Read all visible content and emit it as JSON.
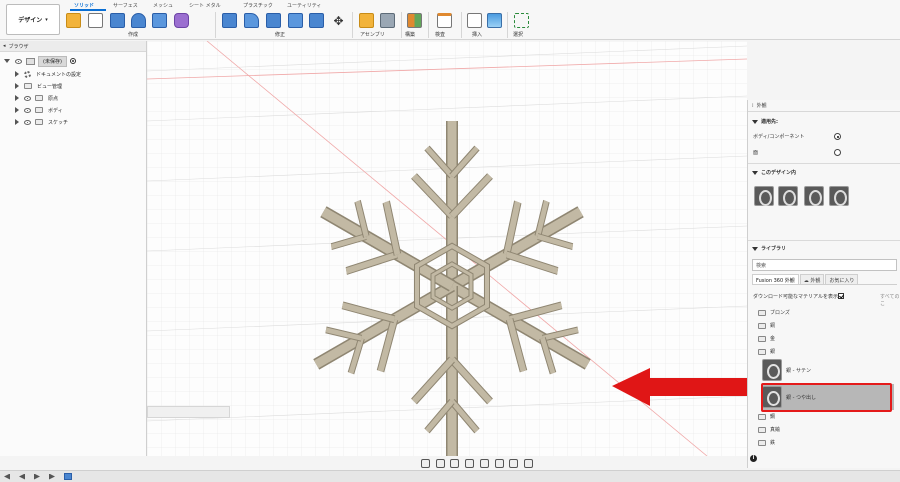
{
  "toolbar": {
    "design_button": "デザイン",
    "tabs": [
      "ソリッド",
      "サーフェス",
      "メッシュ",
      "シート メタル",
      "プラスチック",
      "ユーティリティ"
    ],
    "groups": [
      "作成",
      "修正",
      "アセンブリ",
      "構築",
      "検査",
      "挿入",
      "選択"
    ]
  },
  "browser": {
    "title": "ブラウザ",
    "root": "(未保存)",
    "items": [
      "ドキュメントの設定",
      "ビュー管理",
      "原点",
      "ボディ",
      "スケッチ"
    ]
  },
  "appearance": {
    "title": "外観",
    "apply_to": {
      "heading": "適用先:",
      "options": [
        "ボディ/コンポーネント",
        "面"
      ],
      "selected": "ボディ/コンポーネント"
    },
    "in_design": {
      "heading": "このデザイン内",
      "count": 4
    },
    "library": {
      "heading": "ライブラリ",
      "search_placeholder": "検索",
      "tabs": [
        "Fusion 360 外観",
        "外観",
        "お気に入り"
      ],
      "downloadable_label": "ダウンロード可能なマテリアルを表示",
      "downloadable_checked": true,
      "grey_hint": "すべてのこ",
      "folders_top": [
        "ブロンズ",
        "銅",
        "金",
        "銀"
      ],
      "materials": [
        "銀 - サテン",
        "銀 - つや出し"
      ],
      "selected_material": "銀 - つや出し",
      "folders_bottom": [
        "鋼",
        "真鍮",
        "鉄"
      ]
    }
  },
  "colors": {
    "accent": "#0a6fd4",
    "highlight_box": "#e41a1a",
    "arrow": "#e01616",
    "snowflake": "#bcb39f"
  },
  "icons": {
    "orbit": "orbit-icon",
    "pan": "pan-icon",
    "zoom": "zoom-icon",
    "display": "display-settings-icon",
    "grid": "grid-settings-icon",
    "info": "info-icon"
  }
}
